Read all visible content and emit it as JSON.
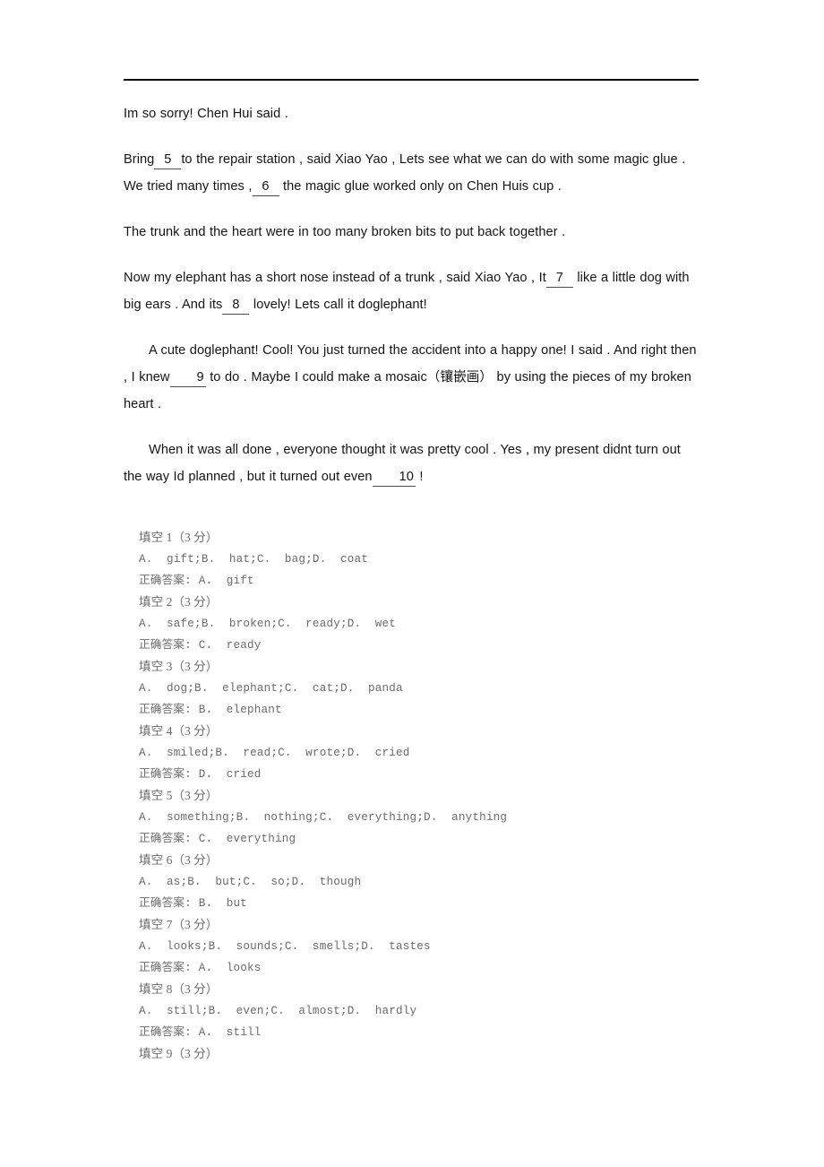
{
  "document": {
    "type": "cloze-test-worksheet",
    "header_rule": true
  },
  "passage": {
    "paragraphs": [
      {
        "id": "p1",
        "indent": false,
        "segments": [
          {
            "type": "text",
            "value": "Im so sorry! Chen Hui said ."
          }
        ],
        "plain": "Im so sorry! Chen Hui said ."
      },
      {
        "id": "p2",
        "indent": false,
        "segments": [
          {
            "type": "text",
            "value": "Bring"
          },
          {
            "type": "blank",
            "value": "5"
          },
          {
            "type": "text",
            "value": "to the repair station ,   said Xiao Yao ,   Lets see what we can do with some magic glue . We tried many times ,"
          },
          {
            "type": "blank",
            "value": "6"
          },
          {
            "type": "text",
            "value": "the magic glue worked only on Chen Huis cup ."
          }
        ],
        "plain": "Bring 5 to the repair station , said Xiao Yao , Lets see what we can do with some magic glue . We tried many times , 6 the magic glue worked only on Chen Huis cup ."
      },
      {
        "id": "p3",
        "indent": false,
        "segments": [
          {
            "type": "text",
            "value": "The trunk and the heart were in too many broken bits to put back together ."
          }
        ],
        "plain": "The trunk and the heart were in too many broken bits to put back together ."
      },
      {
        "id": "p4",
        "indent": false,
        "segments": [
          {
            "type": "text",
            "value": "Now my elephant has a short nose instead of a trunk ,   said Xiao Yao , It"
          },
          {
            "type": "blank",
            "value": "7"
          },
          {
            "type": "text",
            "value": "like a little dog with big ears .   And its"
          },
          {
            "type": "blank",
            "value": "8"
          },
          {
            "type": "text",
            "value": "lovely! Lets call it doglephant!"
          }
        ],
        "plain": "Now my elephant has a short nose instead of a trunk , said Xiao Yao , It 7 like a little dog with big ears . And its 8 lovely! Lets call it doglephant!"
      },
      {
        "id": "p5",
        "indent": true,
        "segments": [
          {
            "type": "text",
            "value": "A cute doglephant! Cool! You just turned the accident into a happy one! I said . And right then , I knew"
          },
          {
            "type": "blank",
            "value": "9"
          },
          {
            "type": "text",
            "value": "to do .   Maybe I could make a mosaic（镶嵌画）  by using the pieces of my broken heart ."
          }
        ],
        "plain": "A cute doglephant! Cool! You just turned the accident into a happy one! I said . And right then , I knew 9 to do . Maybe I could make a mosaic（镶嵌画） by using the pieces of my broken heart ."
      },
      {
        "id": "p6",
        "indent": true,
        "segments": [
          {
            "type": "text",
            "value": "When it was all done , everyone thought it was pretty cool . Yes , my present didnt turn out the way Id planned ,   but it turned out even"
          },
          {
            "type": "blank",
            "value": "10"
          },
          {
            "type": "text",
            "value": "!"
          }
        ],
        "plain": "When it was all done , everyone thought it was pretty cool . Yes , my present didnt turn out the way Id planned , but it turned out even 10 !"
      }
    ]
  },
  "answer_key": {
    "answer_label": "正确答案:",
    "entries": [
      {
        "heading": "填空 1（3 分）",
        "options": "A.  gift;B.  hat;C.  bag;D.  coat",
        "answer": "正确答案: A.  gift"
      },
      {
        "heading": "填空 2（3 分）",
        "options": "A.  safe;B.  broken;C.  ready;D.  wet",
        "answer": "正确答案: C.  ready"
      },
      {
        "heading": "填空 3（3 分）",
        "options": "A.  dog;B.  elephant;C.  cat;D.  panda",
        "answer": "正确答案: B.  elephant"
      },
      {
        "heading": "填空 4（3 分）",
        "options": "A.  smiled;B.  read;C.  wrote;D.  cried",
        "answer": "正确答案: D.  cried"
      },
      {
        "heading": "填空 5（3 分）",
        "options": "A.  something;B.  nothing;C.  everything;D.  anything",
        "answer": "正确答案: C.  everything"
      },
      {
        "heading": "填空 6（3 分）",
        "options": "A.  as;B.  but;C.  so;D.  though",
        "answer": "正确答案: B.  but"
      },
      {
        "heading": "填空 7（3 分）",
        "options": "A.  looks;B.  sounds;C.  smells;D.  tastes",
        "answer": "正确答案: A.  looks"
      },
      {
        "heading": "填空 8（3 分）",
        "options": "A.  still;B.  even;C.  almost;D.  hardly",
        "answer": "正确答案: A.  still"
      },
      {
        "heading": "填空 9（3 分）",
        "options": "",
        "answer": ""
      }
    ]
  }
}
